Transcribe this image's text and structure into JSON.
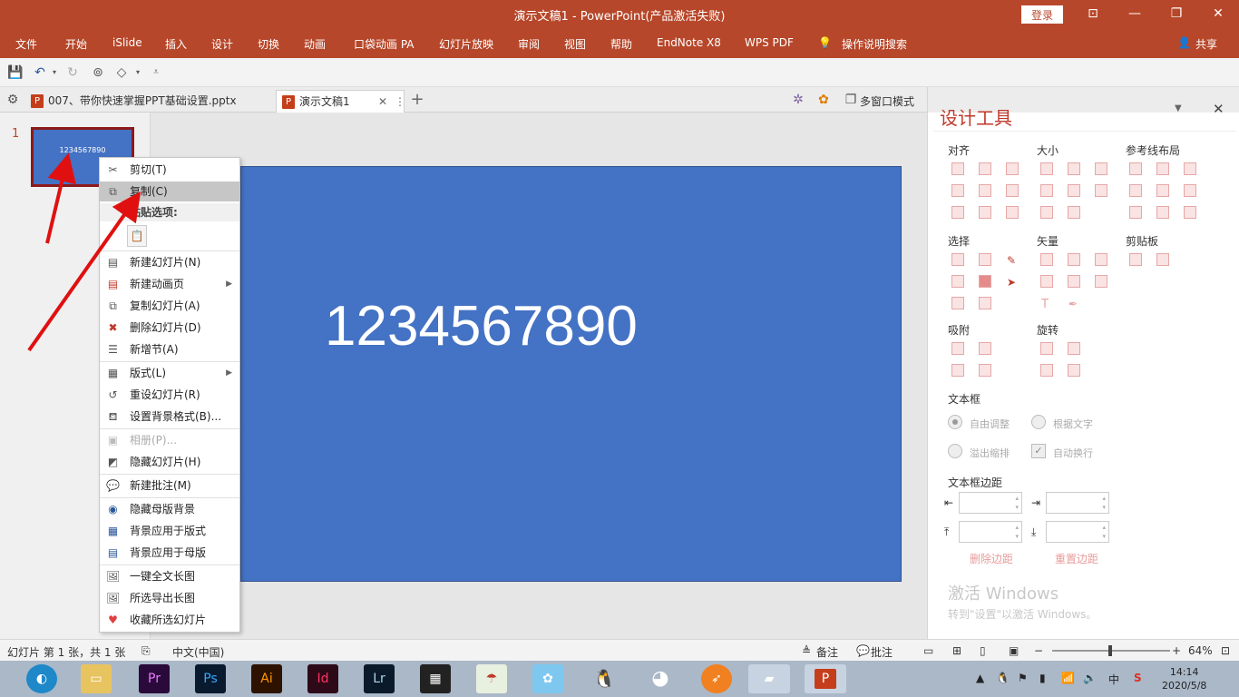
{
  "window": {
    "title": "演示文稿1  -  PowerPoint(产品激活失败)",
    "login_label": "登录"
  },
  "ribbon": {
    "tabs": [
      "文件",
      "开始",
      "iSlide",
      "插入",
      "设计",
      "切换",
      "动画",
      "口袋动画 PA",
      "幻灯片放映",
      "审阅",
      "视图",
      "帮助",
      "EndNote X8",
      "WPS PDF",
      "操作说明搜索"
    ],
    "share_label": "共享"
  },
  "doc_tabs": {
    "tab1": "007、带你快速掌握PPT基础设置.pptx",
    "tab2": "演示文稿1",
    "multi_window": "多窗口模式"
  },
  "slide_panel": {
    "number": "1",
    "thumb_text": "1234567890"
  },
  "slide": {
    "text": "1234567890",
    "bg_color": "#4472c4"
  },
  "context_menu": {
    "cut": "剪切(T)",
    "copy": "复制(C)",
    "paste_options": "粘贴选项:",
    "new_slide": "新建幻灯片(N)",
    "new_anim_page": "新建动画页",
    "duplicate_slide": "复制幻灯片(A)",
    "delete_slide": "删除幻灯片(D)",
    "add_section": "新增节(A)",
    "layout": "版式(L)",
    "reset_slide": "重设幻灯片(R)",
    "format_background": "设置背景格式(B)...",
    "photo_album": "相册(P)...",
    "hide_slide": "隐藏幻灯片(H)",
    "new_comment": "新建批注(M)",
    "hide_master_bg": "隐藏母版背景",
    "apply_bg_layout": "背景应用于版式",
    "apply_bg_master": "背景应用于母版",
    "long_image_all": "一键全文长图",
    "export_long_image": "所选导出长图",
    "favorite_slides": "收藏所选幻灯片"
  },
  "design_pane": {
    "title": "设计工具",
    "align": "对齐",
    "size": "大小",
    "guides": "参考线布局",
    "select": "选择",
    "vector": "矢量",
    "clipboard": "剪贴板",
    "snap": "吸附",
    "rotate": "旋转",
    "textbox": "文本框",
    "autofit": "自由调整",
    "fit_text": "根据文字",
    "shrink": "溢出缩排",
    "wrap": "自动换行",
    "margins": "文本框边距",
    "delete_margin": "删除边距",
    "reset_margin": "重置边距"
  },
  "watermark": {
    "line1": "激活 Windows",
    "line2": "转到\"设置\"以激活 Windows。"
  },
  "status": {
    "slide_info": "幻灯片 第 1 张，共 1 张",
    "language": "中文(中国)",
    "notes": "备注",
    "comments": "批注",
    "zoom": "64%"
  },
  "taskbar": {
    "time": "14:14",
    "date": "2020/5/8",
    "ime": "中",
    "apps": [
      "Pr",
      "Ps",
      "Ai",
      "Id",
      "Lr"
    ]
  }
}
